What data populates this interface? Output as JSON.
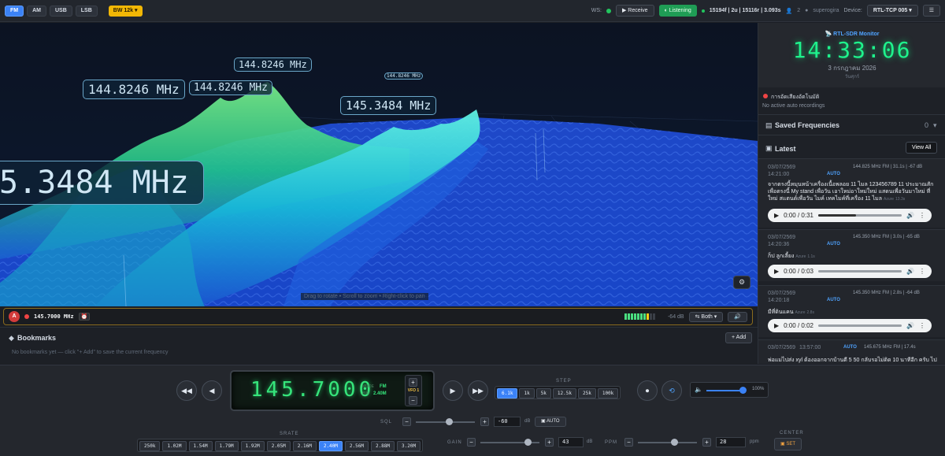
{
  "topbar": {
    "modes": [
      "FM",
      "AM",
      "USB",
      "LSB"
    ],
    "bw": "BW 12k",
    "ws_label": "WS:",
    "receive": "Receive",
    "listening": "Listening",
    "stats": "15194f | 2u | 15116r | 3.093s",
    "users": "2",
    "user": "superogira",
    "device_label": "Device:",
    "device": "RTL-TCP 005",
    "colors": {
      "accent": "#3b82f6",
      "bw": "#f2b705",
      "listening": "#1f9d55"
    }
  },
  "viz": {
    "labels": [
      "144.8246 MHz",
      "144.8246 MHz",
      "144.8246 MHz",
      "144.8246 MHz",
      "145.3484 MHz",
      "5.3484 MHz"
    ],
    "hint": "Drag to rotate • Scroll to zoom • Right-click to pan",
    "gear": "⚙"
  },
  "radio_bar": {
    "badge": "A",
    "freq": "145.7000 MHz",
    "db": "-64 dB",
    "output": "Both"
  },
  "bookmarks": {
    "title": "Bookmarks",
    "add": "+ Add",
    "empty": "No bookmarks yet — click \"+ Add\" to save the current frequency"
  },
  "sidebar": {
    "title": "RTL-SDR Monitor",
    "time": "14:33:06",
    "date": "3 กรกฎาคม 2026",
    "day": "วันศุกร์",
    "auto_title": "การอัดเสียงอัตโนมัติ",
    "auto_status": "No active auto recordings",
    "saved": "Saved Frequencies",
    "saved_count": "0",
    "latest": "Latest",
    "view_all": "View All",
    "entries": [
      {
        "date": "03/07/2569",
        "time": "14:21:00",
        "auto": "AUTO",
        "meta": "144.825 MHz FM | 31.1s | -67 dB",
        "text": "จากตรงนี้หมุนหน้าเครื่องเนื้อพลอย 11 ไมล 123456789 11 ประมาณสักเพื่อตรงนี้ My stand เพื่อวัน เอาใหม่อาใหม่ใหม่ แสดนเพื่อวันมาใหม่ ที่ ใหม่ สแตนด์เพื่อวัน ไมค์ เทคไมค์ที่เครื่อง 11 ไมล",
        "src": "Azure",
        "conf": "13.3s",
        "player": "0:00 / 0:31",
        "progress": 0.45
      },
      {
        "date": "03/07/2569",
        "time": "14:20:36",
        "auto": "AUTO",
        "meta": "145.350 MHz FM | 3.0s | -65 dB",
        "text": "ก็ป ลูกเลี้ยง",
        "src": "Azure",
        "conf": "1.1s",
        "player": "0:00 / 0:03",
        "progress": 0
      },
      {
        "date": "03/07/2569",
        "time": "14:20:18",
        "auto": "AUTO",
        "meta": "145.350 MHz FM | 2.8s | -64 dB",
        "text": "มีที่ดินแคน",
        "src": "Azure",
        "conf": "2.8s",
        "player": "0:00 / 0:02",
        "progress": 0
      },
      {
        "date": "03/07/2569",
        "time": "13:57:00",
        "auto": "AUTO",
        "meta": "145.675 MHz FM | 17.4s",
        "text": "พ่อแม่ไปส่ง xyl ต้องออกจากบ้านตี 5 50 กลับรอไม่ติด 10 นาทีอีก ครับ ไป",
        "src": "",
        "conf": "",
        "player": "",
        "progress": 0
      }
    ]
  },
  "controls": {
    "freq": "145.7000",
    "mode_label": "MODE",
    "mode": "FM",
    "bw_label": "BW",
    "bw_val": "2.40M",
    "vfo": "VFO 1",
    "step_title": "STEP",
    "steps": [
      "6.1k",
      "1k",
      "5k",
      "12.5k",
      "25k",
      "100k"
    ],
    "step_sel": 0,
    "volume": "100%",
    "volume_level": 1.0,
    "sql_label": "SQL",
    "sql": "-60",
    "sql_unit": "dB",
    "sql_auto": "AUTO",
    "srate_title": "SRATE",
    "srates": [
      "250k",
      "1.02M",
      "1.54M",
      "1.79M",
      "1.92M",
      "2.05M",
      "2.16M",
      "2.40M",
      "2.56M",
      "2.88M",
      "3.20M"
    ],
    "srate_sel": 7,
    "gain_label": "GAIN",
    "gain": "43",
    "gain_unit": "dB",
    "ppm_label": "PPM",
    "ppm": "28",
    "ppm_unit": "ppm",
    "center_title": "CENTER",
    "center_btn": "SET"
  }
}
